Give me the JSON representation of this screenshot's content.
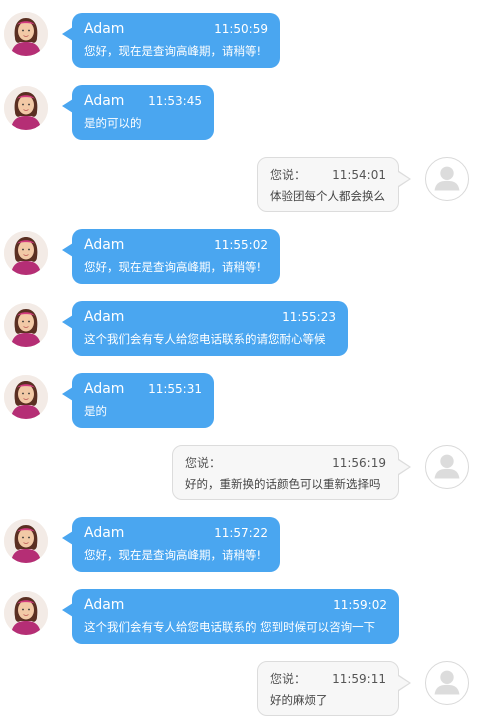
{
  "colors": {
    "agent_bubble": "#4aa6f0",
    "user_bubble": "#f7f7f7",
    "user_border": "#dcdcdc"
  },
  "messages": [
    {
      "role": "agent",
      "sender": "Adam",
      "time": "11:50:59",
      "text": "您好，现在是查询高峰期，请稍等!"
    },
    {
      "role": "agent",
      "sender": "Adam",
      "time": "11:53:45",
      "text": "是的可以的"
    },
    {
      "role": "user",
      "sender": "您说：",
      "time": "11:54:01",
      "text": "体验团每个人都会换么"
    },
    {
      "role": "agent",
      "sender": "Adam",
      "time": "11:55:02",
      "text": "您好，现在是查询高峰期，请稍等!"
    },
    {
      "role": "agent",
      "sender": "Adam",
      "time": "11:55:23",
      "text": "这个我们会有专人给您电话联系的请您耐心等候"
    },
    {
      "role": "agent",
      "sender": "Adam",
      "time": "11:55:31",
      "text": "是的"
    },
    {
      "role": "user",
      "sender": "您说：",
      "time": "11:56:19",
      "text": "好的，重新换的话颜色可以重新选择吗"
    },
    {
      "role": "agent",
      "sender": "Adam",
      "time": "11:57:22",
      "text": "您好，现在是查询高峰期，请稍等!"
    },
    {
      "role": "agent",
      "sender": "Adam",
      "time": "11:59:02",
      "text": "这个我们会有专人给您电话联系的 您到时候可以咨询一下"
    },
    {
      "role": "user",
      "sender": "您说：",
      "time": "11:59:11",
      "text": "好的麻烦了"
    }
  ]
}
